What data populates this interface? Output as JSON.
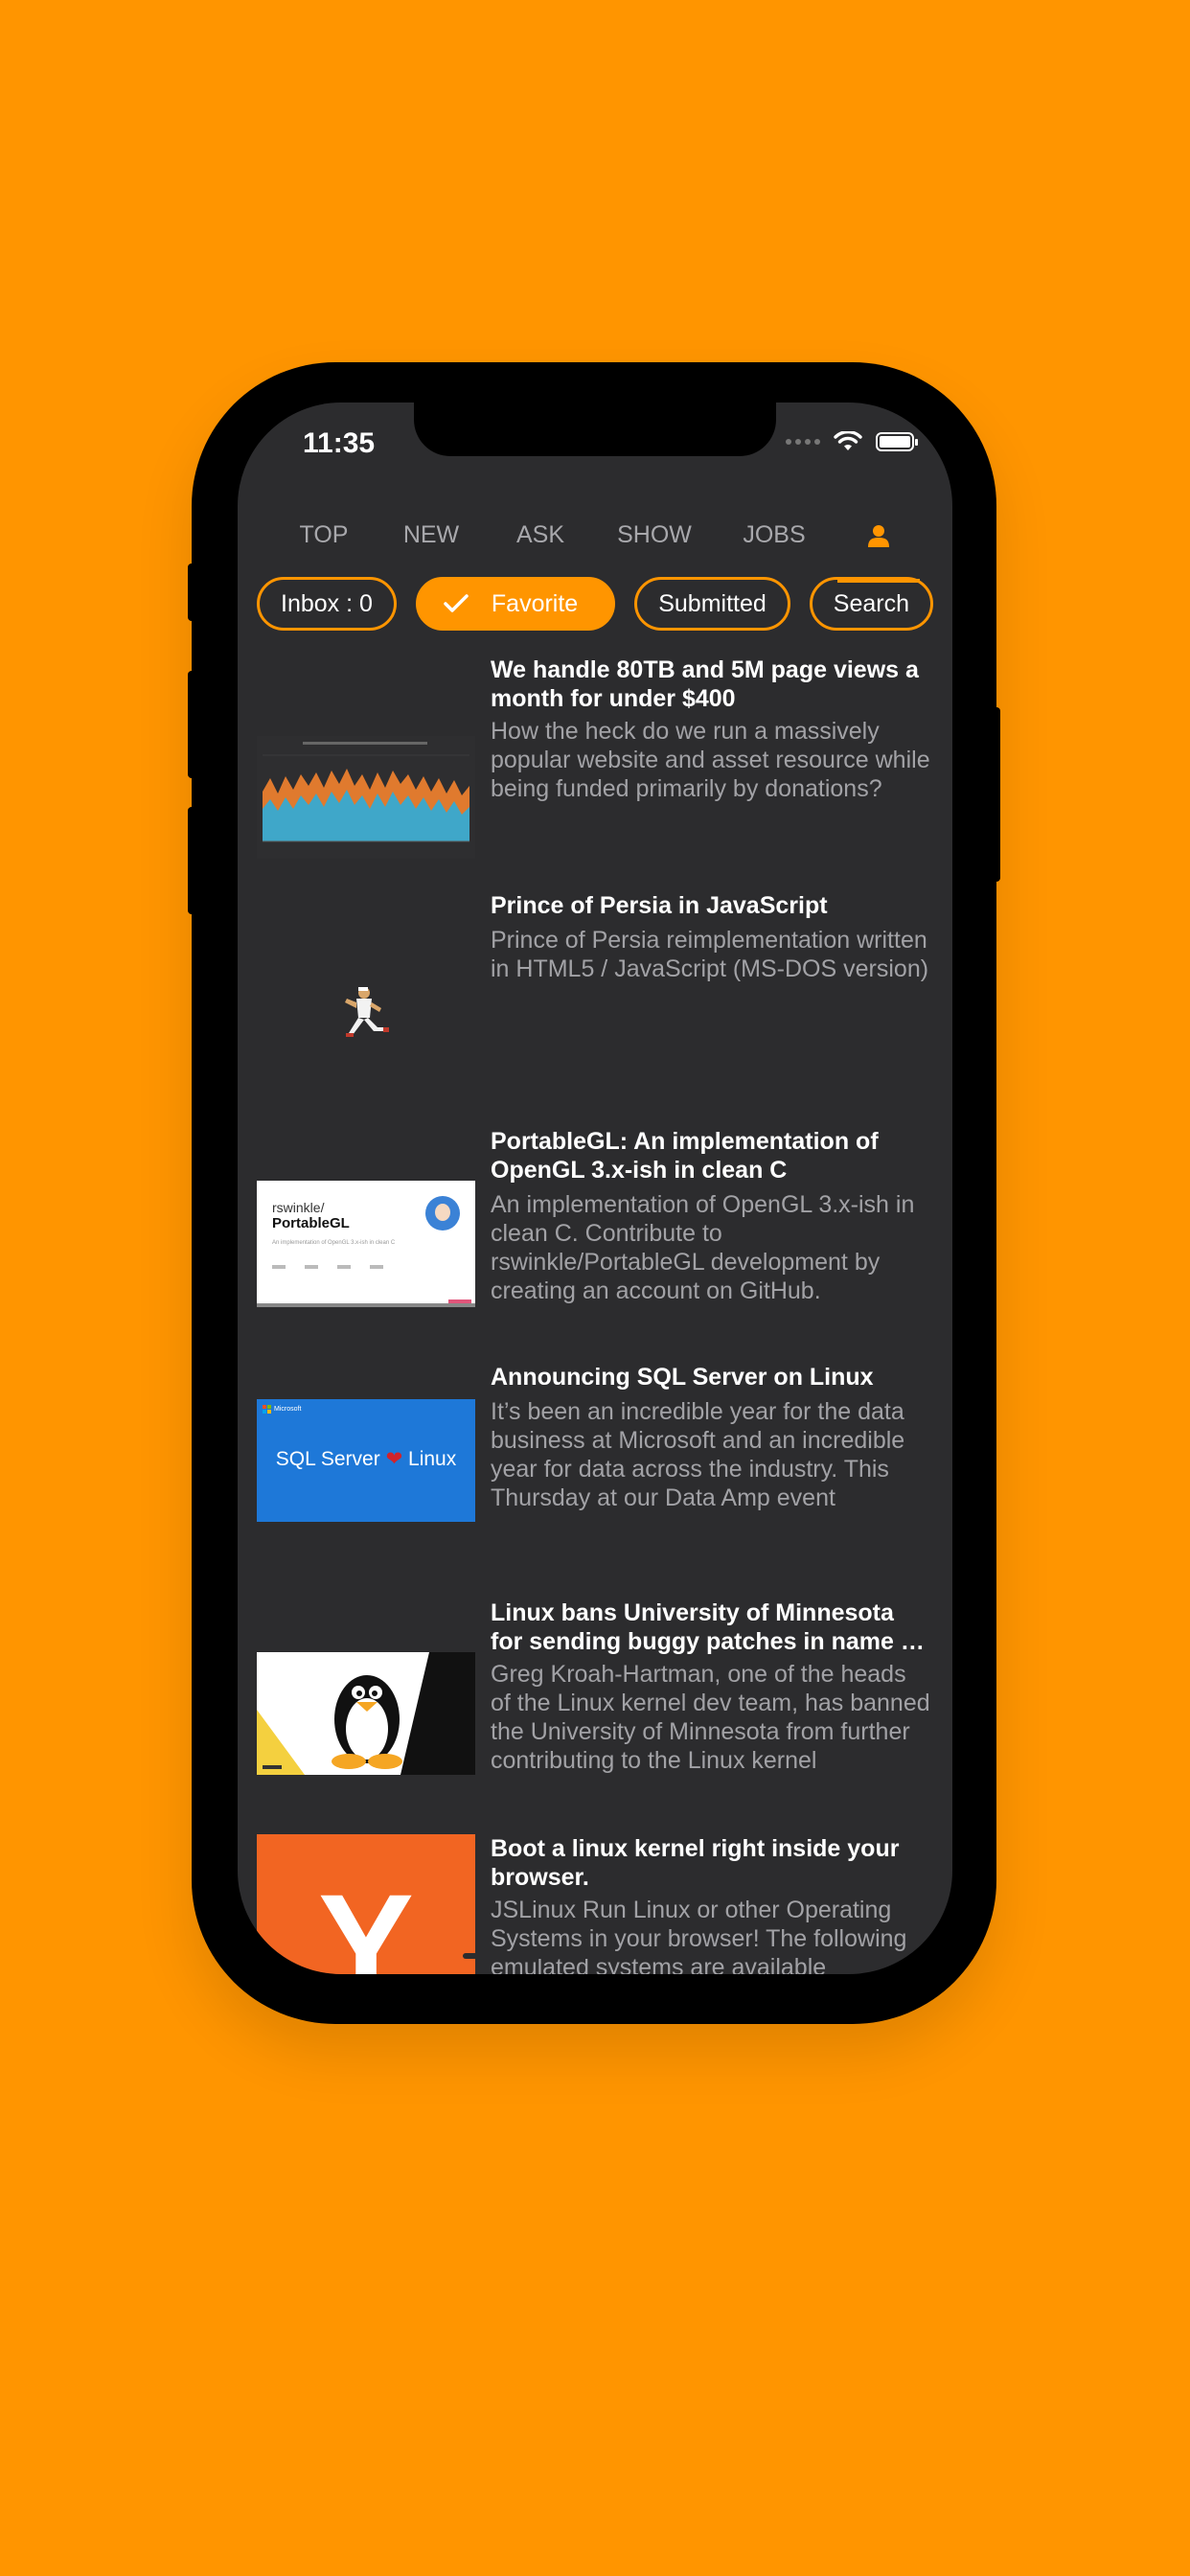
{
  "status_bar": {
    "time": "11:35"
  },
  "tabs": [
    {
      "label": "TOP"
    },
    {
      "label": "NEW"
    },
    {
      "label": "ASK"
    },
    {
      "label": "SHOW"
    },
    {
      "label": "JOBS"
    },
    {
      "icon": "person-icon",
      "active": true
    }
  ],
  "chips": [
    {
      "label": "Inbox : 0"
    },
    {
      "label": "Favorite",
      "selected": true
    },
    {
      "label": "Submitted"
    },
    {
      "label": "Search"
    }
  ],
  "stories": [
    {
      "title": "We handle 80TB and 5M page views a month for under $400",
      "description": "How the heck do we run a massively popular website and asset resource while being funded primarily by donations?",
      "thumbnail": "area-chart-thumbnail"
    },
    {
      "title": "Prince of Persia in JavaScript",
      "description": "Prince of Persia reimplementation written in HTML5 / JavaScript (MS-DOS version)",
      "thumbnail": "running-prince-sprite"
    },
    {
      "title": "PortableGL: An implementation of OpenGL 3.x-ish in clean C",
      "description": "An implementation of OpenGL 3.x-ish in clean C. Contribute to rswinkle/PortableGL development by creating an account on GitHub.",
      "thumbnail": "github-card",
      "thumb_owner": "rswinkle/",
      "thumb_repo": "PortableGL",
      "thumb_sub": "An implementation of OpenGL 3.x-ish in clean C"
    },
    {
      "title": "Announcing SQL Server on Linux",
      "description": "It’s been an incredible year for the data business at Microsoft and an incredible year for data across the industry. This Thursday at our Data Amp event",
      "thumbnail": "sql-server-linux-banner",
      "thumb_brand": "Microsoft",
      "thumb_left": "SQL Server",
      "thumb_right": "Linux"
    },
    {
      "title": "Linux bans University of Minnesota for sending buggy patches in name of research",
      "description": "Greg Kroah-Hartman, one of the heads of the Linux kernel dev team, has banned the University of Minnesota from further contributing to the Linux kernel",
      "thumbnail": "tux-penguin-banner"
    },
    {
      "title": "Boot a linux kernel right inside your browser.",
      "description": "JSLinux Run Linux or other Operating Systems in your browser! The following emulated systems are available",
      "thumbnail": "y-combinator-logo",
      "thumb_letter": "Y"
    }
  ],
  "colors": {
    "accent": "#FF9500",
    "screen_bg": "#2c2c2e",
    "title_text": "#FFFFFF",
    "desc_text": "#A2A2A6"
  }
}
